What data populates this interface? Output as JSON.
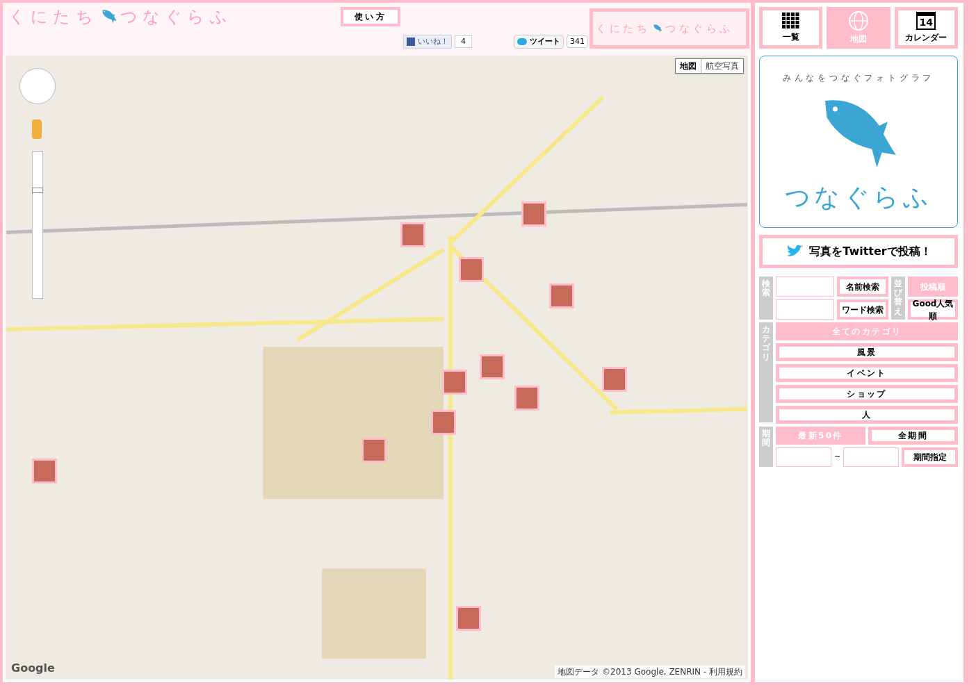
{
  "header": {
    "logo_left": "くにたち",
    "logo_right": "つなぐらふ",
    "help_button": "使い方",
    "like_button": "いいね！",
    "like_count": "4",
    "tweet_button": "ツイート",
    "tweet_count": "341",
    "banner_left": "くにたち",
    "banner_right": "つなぐらふ"
  },
  "map": {
    "zoom": {
      "level": 0.72
    },
    "types": [
      {
        "label": "地図",
        "selected": true
      },
      {
        "label": "航空写真",
        "selected": false
      }
    ],
    "attribution": "地図データ ©2013 Google, ZENRIN - 利用規約",
    "logo": "Google"
  },
  "nav": [
    {
      "label": "一覧",
      "kind": "grid",
      "selected": false
    },
    {
      "label": "地図",
      "kind": "globe",
      "selected": true
    },
    {
      "label": "カレンダー",
      "kind": "calendar",
      "selected": false,
      "day": "14"
    }
  ],
  "brand": {
    "tagline": "みんなをつなぐフォトグラフ",
    "name": "つなぐらふ"
  },
  "twitter_post": "写真をTwitterで投稿！",
  "search": {
    "label": "検索",
    "buttons": [
      "名前検索",
      "ワード検索"
    ]
  },
  "sort": {
    "label": "並び替え",
    "options": [
      {
        "label": "投稿順",
        "selected": true
      },
      {
        "label": "Good人気順",
        "selected": false
      }
    ]
  },
  "category": {
    "label": "カテゴリ",
    "options": [
      {
        "label": "全てのカテゴリ",
        "selected": true
      },
      {
        "label": "風景",
        "selected": false
      },
      {
        "label": "イベント",
        "selected": false
      },
      {
        "label": "ショップ",
        "selected": false
      },
      {
        "label": "人",
        "selected": false
      }
    ]
  },
  "period": {
    "label": "期間",
    "options": [
      {
        "label": "最新50件",
        "selected": true
      },
      {
        "label": "全期間",
        "selected": false
      }
    ],
    "separator": "~",
    "button": "期間指定"
  }
}
